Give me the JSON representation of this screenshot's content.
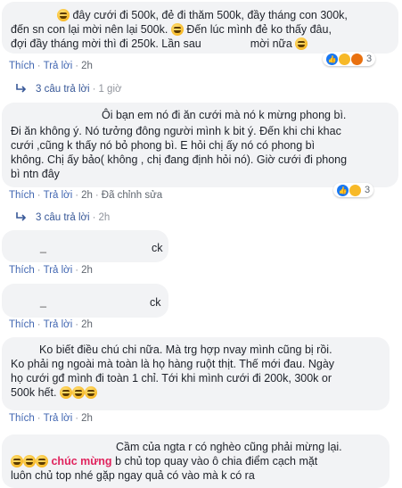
{
  "comments": [
    {
      "lines": [
        "đây cưới đi 500k, đẻ đi thăm 500k, đầy tháng con 300k,",
        "đến sn con lại mời nên lại 500k.",
        "Đến lúc mình đẻ ko thấy đâu,",
        "đợi đầy tháng mời thì đi 250k. Lần sau",
        "mời nữa"
      ],
      "reaction_count": "3",
      "actions": {
        "like": "Thích",
        "reply": "Trả lời",
        "time": "2h"
      },
      "replies": {
        "count_label": "3 câu trả lời",
        "time": "1 giờ"
      }
    },
    {
      "lines": [
        "Ôi bạn em nó đi ăn cưới mà nó k mừng phong bì.",
        "Đi ăn không ý. Nó tưởng đông người mình k bit ý. Đến khi chi khac",
        "cưới ,cũng k thấy nó bỏ phong bì. E hỏi chị ấy nó có phong bì",
        "không. Chị ấy bảo( không , chị đang định hỏi nó). Giờ cưới đi phong",
        "bì ntn đây"
      ],
      "reaction_count": "3",
      "actions": {
        "like": "Thích",
        "reply": "Trả lời",
        "time": "2h",
        "edited": "Đã chỉnh sửa"
      },
      "replies": {
        "count_label": "3 câu trả lời",
        "time": "2h"
      }
    },
    {
      "lines": [
        "_",
        "ck"
      ],
      "actions": {
        "like": "Thích",
        "reply": "Trả lời",
        "time": "2h"
      }
    },
    {
      "lines": [
        "_",
        "ck"
      ],
      "actions": {
        "like": "Thích",
        "reply": "Trả lời",
        "time": "2h"
      }
    },
    {
      "lines": [
        "Ko biết điều chú chi nữa. Mà trg hợp nvay mình cũng bị rồi.",
        "Ko phải ng ngoài mà toàn là họ hàng ruột thịt. Thế mới đau. Ngày",
        "họ cưới gđ mình đi toàn 1 chỉ. Tới khi mình cưới đi 200k, 300k or",
        "500k hết."
      ],
      "actions": {
        "like": "Thích",
        "reply": "Trả lời",
        "time": "2h"
      }
    },
    {
      "lines": [
        "Cầm của ngta r có nghèo cũng phải mừng lại.",
        "chúc mừng",
        "b chủ top quay vào ô chia điểm cạch mặt",
        "luôn chủ top nhé gặp ngay quả có vào mà k có ra"
      ]
    }
  ]
}
